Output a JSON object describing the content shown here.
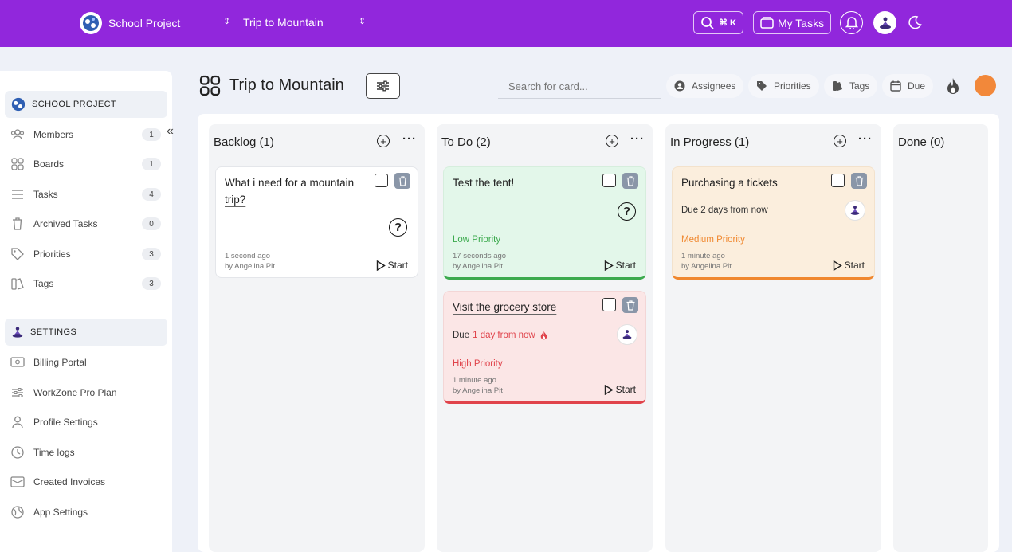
{
  "topbar": {
    "workspace": "School Project",
    "board": "Trip to Mountain",
    "search_shortcut": "⌘ K",
    "my_tasks": "My Tasks"
  },
  "sidebar": {
    "section_project": "SCHOOL PROJECT",
    "items": [
      {
        "label": "Members",
        "count": "1",
        "icon": "members-icon"
      },
      {
        "label": "Boards",
        "count": "1",
        "icon": "boards-icon"
      },
      {
        "label": "Tasks",
        "count": "4",
        "icon": "tasks-icon"
      },
      {
        "label": "Archived Tasks",
        "count": "0",
        "icon": "trash-icon"
      },
      {
        "label": "Priorities",
        "count": "3",
        "icon": "tag-icon"
      },
      {
        "label": "Tags",
        "count": "3",
        "icon": "tags-icon"
      }
    ],
    "section_settings": "SETTINGS",
    "settings": [
      {
        "label": "Billing Portal",
        "icon": "billing-icon"
      },
      {
        "label": "WorkZone Pro Plan",
        "icon": "sliders-icon"
      },
      {
        "label": "Profile Settings",
        "icon": "user-icon"
      },
      {
        "label": "Time logs",
        "icon": "clock-icon"
      },
      {
        "label": "Created Invoices",
        "icon": "invoice-icon"
      },
      {
        "label": "App Settings",
        "icon": "globe-icon"
      }
    ]
  },
  "board": {
    "title": "Trip to Mountain",
    "search_placeholder": "Search for card...",
    "filters": {
      "assignees": "Assignees",
      "priorities": "Priorities",
      "tags": "Tags",
      "due": "Due"
    }
  },
  "columns": [
    {
      "title": "Backlog (1)"
    },
    {
      "title": "To Do (2)"
    },
    {
      "title": "In Progress (1)"
    },
    {
      "title": "Done (0)"
    }
  ],
  "cards": {
    "mountain": {
      "title": "What i need for a mountain trip?",
      "time": "1 second ago",
      "by": "by Angelina Pit",
      "start": "Start"
    },
    "tent": {
      "title": "Test the tent!",
      "priority": "Low Priority",
      "time": "17 seconds ago",
      "by": "by Angelina Pit",
      "start": "Start"
    },
    "grocery": {
      "title": "Visit the grocery store",
      "due_prefix": "Due",
      "due_value": "1 day from now",
      "priority": "High Priority",
      "time": "1 minute ago",
      "by": "by Angelina Pit",
      "start": "Start"
    },
    "tickets": {
      "title": "Purchasing a tickets",
      "due": "Due 2 days from now",
      "priority": "Medium Priority",
      "time": "1 minute ago",
      "by": "by Angelina Pit",
      "start": "Start"
    }
  },
  "colors": {
    "topbar": "#9127dc",
    "low": "#3caa4e",
    "medium": "#f0872e",
    "high": "#e0434b",
    "avatar_dot": "#f2883a"
  }
}
